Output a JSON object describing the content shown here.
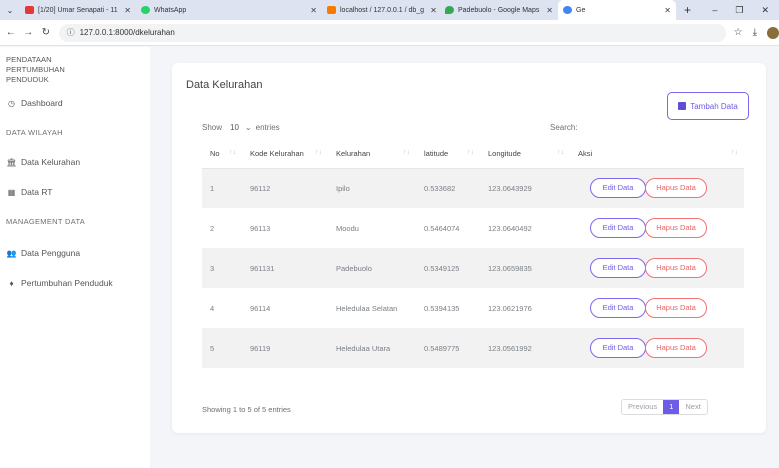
{
  "browser": {
    "tabs": [
      {
        "label": "[1/20] Umar Senapati - 11",
        "icon_color": "#e53935"
      },
      {
        "label": "WhatsApp",
        "icon_color": "#25d366"
      },
      {
        "label": "localhost / 127.0.0.1 / db_g",
        "icon_color": "#f57c00"
      },
      {
        "label": "Padebuolo - Google Maps",
        "icon_color": "#34a853"
      },
      {
        "label": "Ge",
        "icon_color": "#4285f4"
      }
    ],
    "url": "127.0.0.1:8000/dkelurahan"
  },
  "sidebar": {
    "title": "PENDATAAN PERTUMBUHAN PENDUDUK",
    "dashboard": "Dashboard",
    "section_wilayah": "DATA WILAYAH",
    "kelurahan": "Data Kelurahan",
    "rt": "Data RT",
    "section_management": "MANAGEMENT DATA",
    "pengguna": "Data Pengguna",
    "pertumbuhan": "Pertumbuhan Penduduk"
  },
  "main": {
    "title": "Data Kelurahan",
    "add_button": "Tambah Data",
    "show_label": "Show",
    "show_value": "10",
    "entries_label": "entries",
    "search_label": "Search:",
    "columns": [
      "No",
      "Kode Kelurahan",
      "Kelurahan",
      "latitude",
      "Longitude",
      "Aksi"
    ],
    "rows": [
      {
        "no": "1",
        "kode": "96112",
        "kelurahan": "Ipilo",
        "lat": "0.533682",
        "lng": "123.0643929"
      },
      {
        "no": "2",
        "kode": "96113",
        "kelurahan": "Moodu",
        "lat": "0.5464074",
        "lng": "123.0640492"
      },
      {
        "no": "3",
        "kode": "961131",
        "kelurahan": "Padebuolo",
        "lat": "0.5349125",
        "lng": "123.0659835"
      },
      {
        "no": "4",
        "kode": "96114",
        "kelurahan": "Heledulaa Selatan",
        "lat": "0.5394135",
        "lng": "123.0621976"
      },
      {
        "no": "5",
        "kode": "96119",
        "kelurahan": "Heledulaa Utara",
        "lat": "0.5489775",
        "lng": "123.0561992"
      }
    ],
    "edit_label": "Edit Data",
    "hapus_label": "Hapus Data",
    "footer_info": "Showing 1 to 5 of 5 entries",
    "pager": {
      "previous": "Previous",
      "current": "1",
      "next": "Next"
    }
  }
}
